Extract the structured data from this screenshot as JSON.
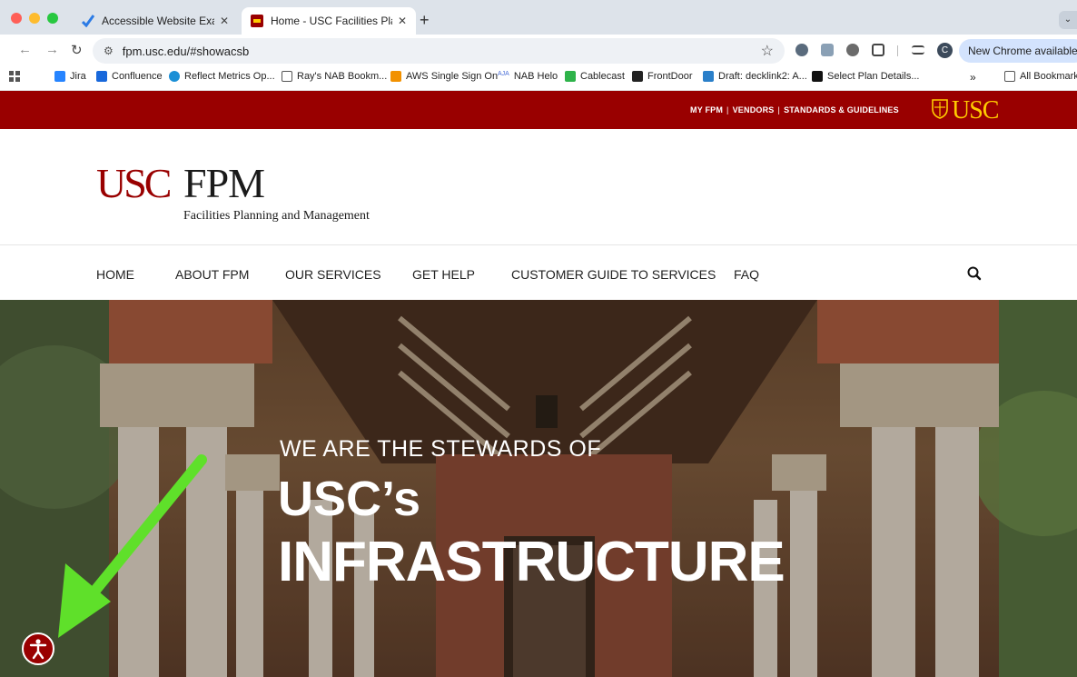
{
  "browser": {
    "tabs": [
      {
        "title": "Accessible Website Examples",
        "active": false
      },
      {
        "title": "Home - USC Facilities Planning",
        "active": true
      }
    ],
    "url": "fpm.usc.edu/#showacsb",
    "profile_initial": "C",
    "update_label": "New Chrome available",
    "bookmarks": [
      "Jira",
      "Confluence",
      "Reflect Metrics Op...",
      "Ray's NAB Bookm...",
      "AWS Single Sign On",
      "NAB Helo",
      "Cablecast",
      "FrontDoor",
      "Draft: decklink2: A...",
      "Select Plan Details..."
    ],
    "bookmarks_overflow": "»",
    "all_bookmarks": "All Bookmarks"
  },
  "site": {
    "utility_links": [
      "MY FPM",
      "VENDORS",
      "STANDARDS & GUIDELINES"
    ],
    "utility_separator": "|",
    "usc_mark": "USC",
    "logo_usc": "USC",
    "logo_fpm": "FPM",
    "logo_subtitle": "Facilities Planning and Management",
    "nav": [
      "HOME",
      "ABOUT FPM",
      "OUR SERVICES",
      "GET HELP",
      "CUSTOMER GUIDE TO SERVICES",
      "FAQ"
    ],
    "hero": {
      "eyebrow": "WE ARE THE STEWARDS OF",
      "line2": "USC’s",
      "line3": "INFRASTRUCTURE"
    },
    "colors": {
      "brand_cardinal": "#990000",
      "brand_gold": "#ffcc00",
      "annotation_arrow": "#5fe02a"
    }
  }
}
